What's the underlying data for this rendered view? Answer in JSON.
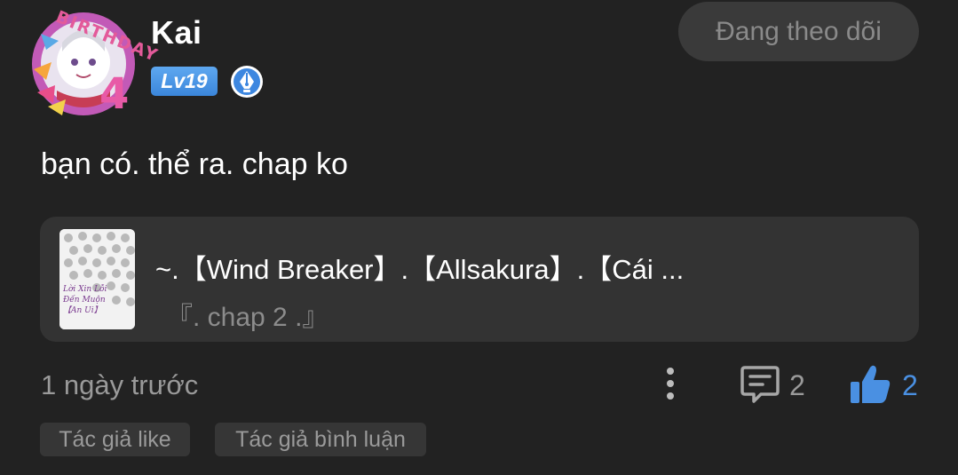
{
  "user": {
    "name": "Kai",
    "level": "Lv19",
    "avatar_frame_text": "BIRTHDAY",
    "avatar_frame_number": "4",
    "icons": {
      "level": "level-badge",
      "role": "pen-badge-icon"
    }
  },
  "follow_button": {
    "label": "Đang theo dõi"
  },
  "comment": {
    "text": "bạn có. thể ra. chap ko"
  },
  "story": {
    "title": "~.【Wind Breaker】.【Allsakura】.【Cái ...",
    "chapter": "『. chap 2 .』",
    "cover_lines": [
      "Lời Xin Lỗi",
      "Đến Muộn",
      "【An Ui】"
    ]
  },
  "meta": {
    "timestamp": "1 ngày trước",
    "comment_count": "2",
    "like_count": "2"
  },
  "tags": [
    "Tác giả like",
    "Tác giả bình luận"
  ],
  "colors": {
    "background": "#222222",
    "accent": "#4a90e2",
    "level_badge": "#4a96e6",
    "muted_text": "#9a9a9a"
  }
}
